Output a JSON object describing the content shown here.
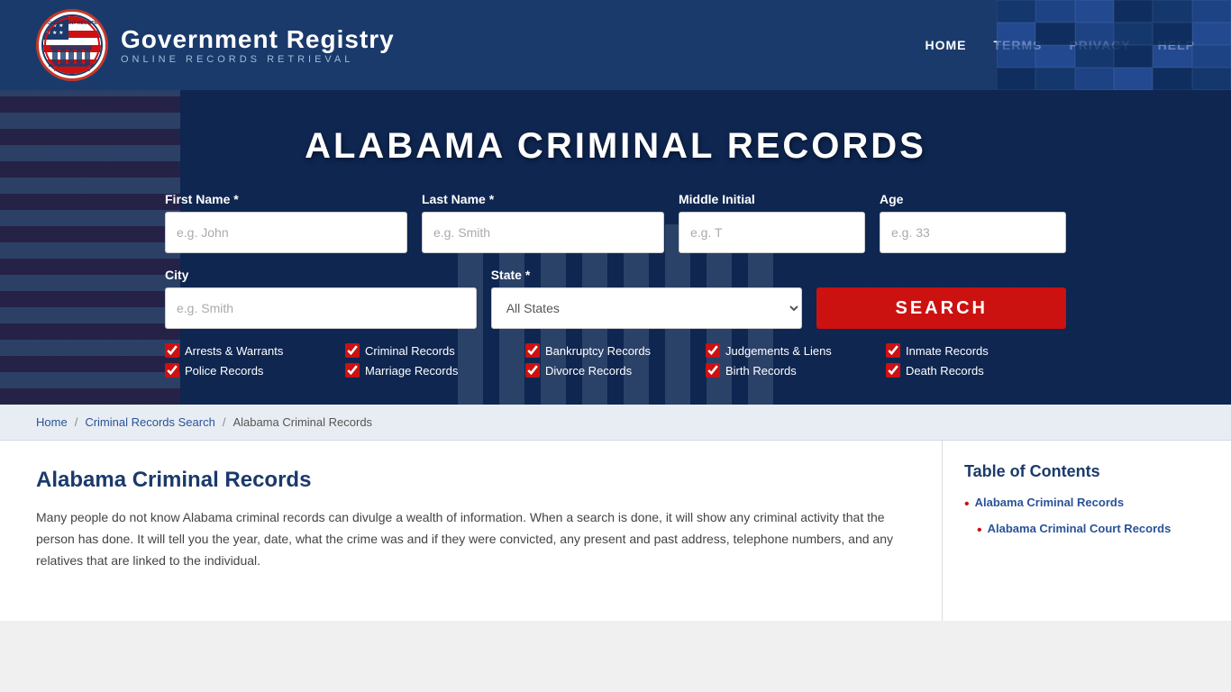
{
  "header": {
    "logo_title": "Government Registry",
    "logo_subtitle": "Online Records Retrieval",
    "nav": [
      "HOME",
      "TERMS",
      "PRIVACY",
      "HELP"
    ]
  },
  "hero": {
    "title": "Alabama Criminal Records",
    "form": {
      "firstname_label": "First Name *",
      "firstname_placeholder": "e.g. John",
      "lastname_label": "Last Name *",
      "lastname_placeholder": "e.g. Smith",
      "middle_label": "Middle Initial",
      "middle_placeholder": "e.g. T",
      "age_label": "Age",
      "age_placeholder": "e.g. 33",
      "city_label": "City",
      "city_placeholder": "e.g. Smith",
      "state_label": "State *",
      "state_value": "All States",
      "search_label": "SEARCH"
    },
    "checkboxes": [
      [
        "Arrests & Warrants",
        "Police Records"
      ],
      [
        "Criminal Records",
        "Marriage Records"
      ],
      [
        "Bankruptcy Records",
        "Divorce Records"
      ],
      [
        "Judgements & Liens",
        "Birth Records"
      ],
      [
        "Inmate Records",
        "Death Records"
      ]
    ]
  },
  "breadcrumb": {
    "home": "Home",
    "criminal": "Criminal Records Search",
    "current": "Alabama Criminal Records"
  },
  "content": {
    "title": "Alabama Criminal Records",
    "body": "Many people do not know Alabama criminal records can divulge a wealth of information. When a search is done, it will show any criminal activity that the person has done. It will tell you the year, date, what the crime was and if they were convicted, any present and past address, telephone numbers, and any relatives that are linked to the individual."
  },
  "toc": {
    "title": "Table of Contents",
    "items": [
      {
        "label": "Alabama Criminal Records",
        "indent": false
      },
      {
        "label": "Alabama Criminal Court Records",
        "indent": true
      }
    ]
  }
}
